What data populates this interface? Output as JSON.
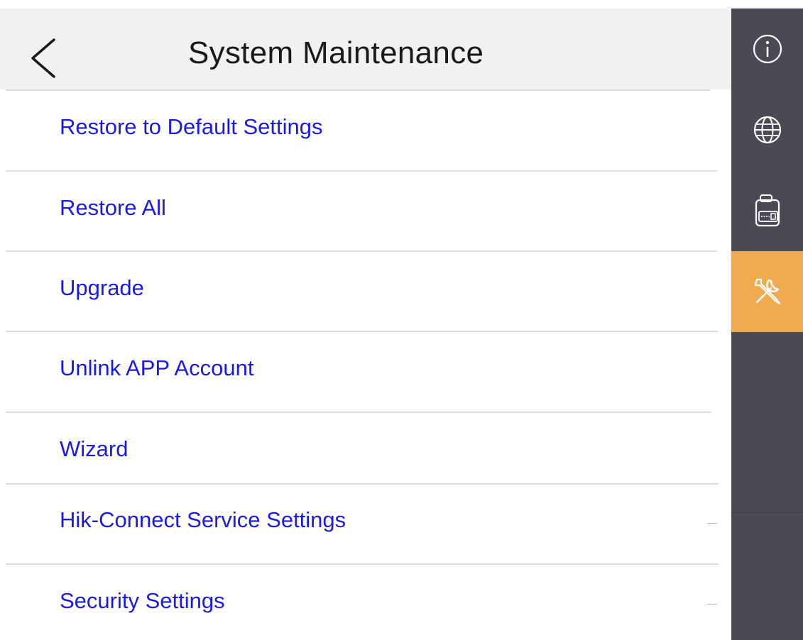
{
  "header": {
    "title": "System Maintenance",
    "back_icon": "chevron-left-icon"
  },
  "menu": {
    "items": [
      {
        "label": "Restore to Default Settings"
      },
      {
        "label": "Restore All"
      },
      {
        "label": "Upgrade"
      },
      {
        "label": "Unlink APP Account"
      },
      {
        "label": "Wizard"
      },
      {
        "label": "Hik-Connect Service Settings"
      },
      {
        "label": "Security Settings"
      }
    ]
  },
  "sidebar": {
    "items": [
      {
        "icon": "info-icon",
        "active": false
      },
      {
        "icon": "globe-icon",
        "active": false
      },
      {
        "icon": "device-icon",
        "active": false
      },
      {
        "icon": "tools-icon",
        "active": true
      }
    ]
  },
  "colors": {
    "header_bg": "#f1f1f1",
    "menu_text": "#1a1ae6",
    "sidebar_bg": "#4a4a54",
    "sidebar_active": "#efaa52",
    "title_text": "#1a1a1a"
  }
}
